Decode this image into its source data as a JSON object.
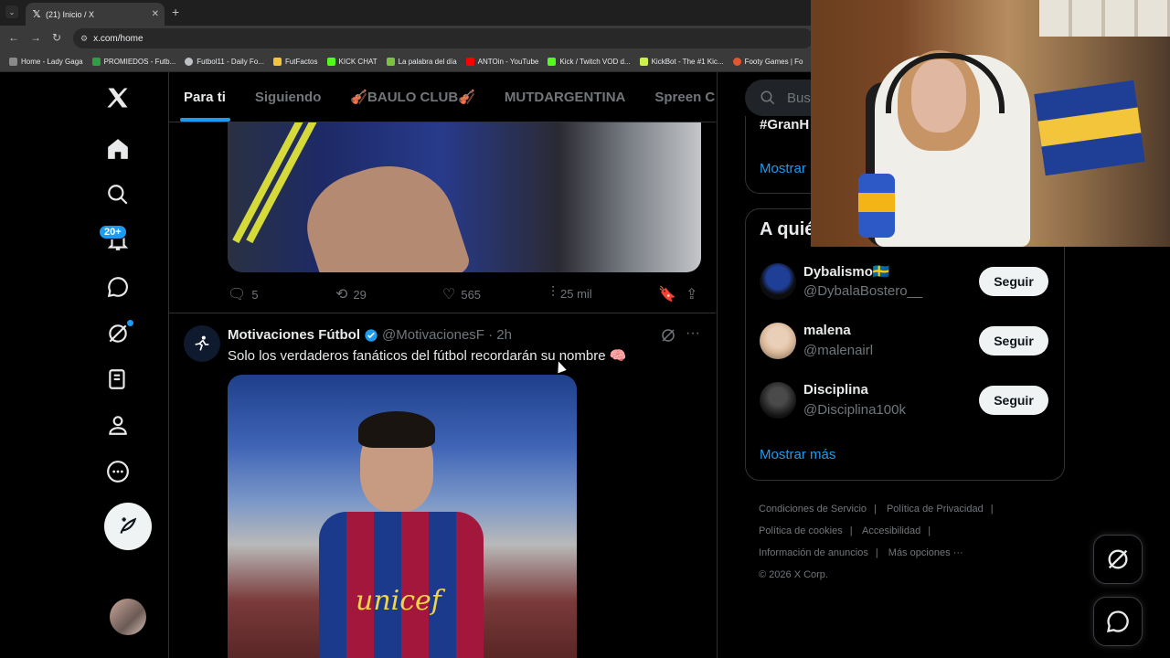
{
  "browser": {
    "tab_title": "(21) Inicio / X",
    "tab_close": "✕",
    "new_tab": "+",
    "url": "x.com/home",
    "bookmarks": [
      {
        "label": "Home - Lady Gaga",
        "color": "#8a8a8a"
      },
      {
        "label": "PROMIEDOS - Futb...",
        "color": "#2f9e44"
      },
      {
        "label": "Futbol11 - Daily Fo...",
        "color": "#bdc1c6"
      },
      {
        "label": "FutFactos",
        "color": "#f2c53a"
      },
      {
        "label": "KICK CHAT",
        "color": "#53fc18"
      },
      {
        "label": "La palabra del día",
        "color": "#7cc242"
      },
      {
        "label": "ANTOin - YouTube",
        "color": "#ff0000"
      },
      {
        "label": "Kick / Twitch VOD d...",
        "color": "#53fc18"
      },
      {
        "label": "KickBot - The #1 Kic...",
        "color": "#c9f24d"
      },
      {
        "label": "Footy Games | Fo",
        "color": "#e4572e"
      }
    ]
  },
  "nav": {
    "badge": "20+",
    "icons": [
      "x-logo-icon",
      "home-icon",
      "search-icon",
      "notifications-icon",
      "messages-icon",
      "grok-icon",
      "lists-icon",
      "profile-icon",
      "more-icon"
    ]
  },
  "tabs": [
    {
      "label": "Para ti",
      "active": true
    },
    {
      "label": "Siguiendo"
    },
    {
      "label": "🎻BAULO CLUB🎻"
    },
    {
      "label": "MUTDARGENTINA"
    },
    {
      "label": "Spreen Cla"
    }
  ],
  "tweet1": {
    "replies": "5",
    "retweets": "29",
    "likes": "565",
    "views": "25 mil"
  },
  "tweet2": {
    "name": "Motivaciones Fútbol",
    "handle": "@MotivacionesF · 2h",
    "text": "Solo los verdaderos fanáticos del fútbol recordarán su nombre 🧠",
    "jersey_text": "unicef"
  },
  "right": {
    "search_placeholder": "Buscar",
    "trend": "#GranH",
    "show_more": "Mostrar más",
    "show_more_partial": "Mostrar",
    "who_title": "A quién seguir",
    "follow_label": "Seguir",
    "suggestions": [
      {
        "name": "Dybalismo🇸🇪",
        "handle": "@DybalaBostero__"
      },
      {
        "name": "malena",
        "handle": "@malenairl"
      },
      {
        "name": "Disciplina",
        "handle": "@Disciplina100k"
      }
    ],
    "footer": {
      "terms": "Condiciones de Servicio",
      "privacy": "Política de Privacidad",
      "cookies": "Política de cookies",
      "accessibility": "Accesibilidad",
      "ads": "Información de anuncios",
      "more": "Más opciones ···",
      "copyright": "© 2026 X Corp."
    }
  },
  "colors": {
    "accent": "#1d9bf0",
    "background": "#000000",
    "text": "#e7e9ea",
    "muted": "#71767b",
    "border": "#2f3336"
  }
}
